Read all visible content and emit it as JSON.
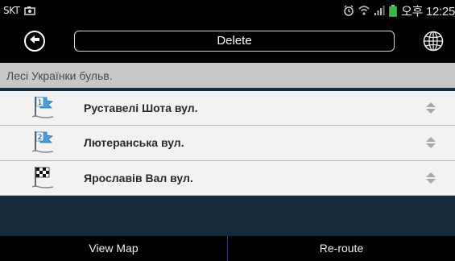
{
  "status_bar": {
    "carrier": "SKT",
    "time": "오후 12:25",
    "icons": [
      "photo-icon",
      "alarm-icon",
      "wifi-icon",
      "signal-icon",
      "battery-icon"
    ]
  },
  "toolbar": {
    "back_icon": "back-arrow-icon",
    "delete_label": "Delete",
    "globe_icon": "globe-icon"
  },
  "route": {
    "start_label": "Лесі Українки бульв.",
    "items": [
      {
        "label": "Руставелі Шота вул.",
        "icon": "waypoint-flag-1-icon",
        "number": "1"
      },
      {
        "label": "Лютеранська вул.",
        "icon": "waypoint-flag-2-icon",
        "number": "2"
      },
      {
        "label": "Ярославів Вал вул.",
        "icon": "checkered-flag-icon"
      }
    ]
  },
  "bottom_bar": {
    "view_map_label": "View Map",
    "reroute_label": "Re-route"
  },
  "colors": {
    "background": "#152a3b",
    "bars": "#000000",
    "header": "#c8c8c8",
    "list_item": "#f2f2f2",
    "flag_blue": "#4a9fd8"
  }
}
